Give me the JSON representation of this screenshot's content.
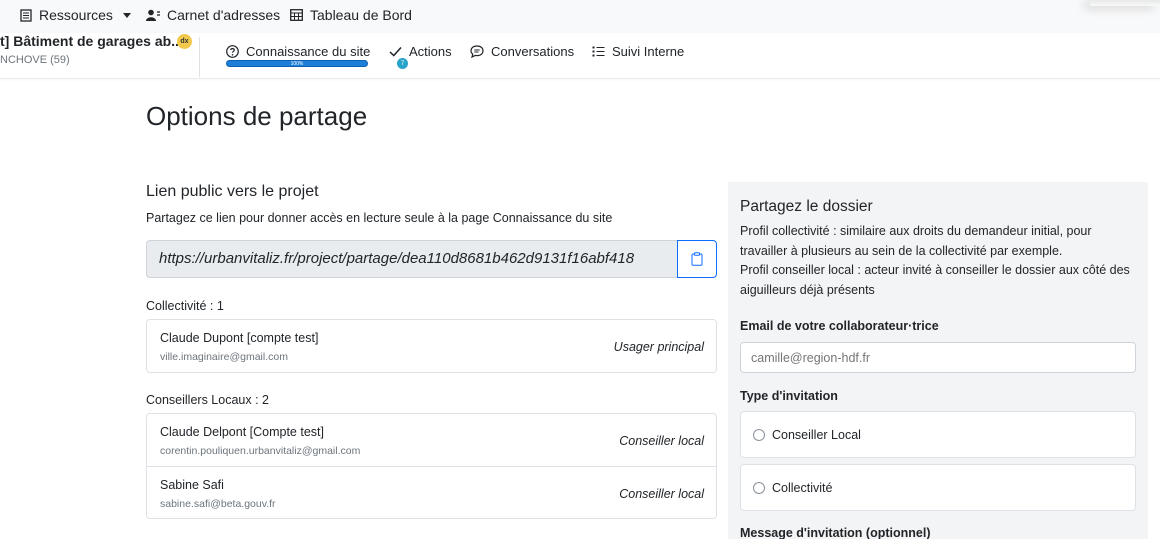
{
  "topnav": {
    "resources_label": "Ressources",
    "contacts_label": "Carnet d'adresses",
    "dashboard_label": "Tableau de Bord"
  },
  "project": {
    "title": "t] Bâtiment de garages ab...",
    "badge": "dx",
    "subtitle": "NCHOVE (59)"
  },
  "tabs": [
    {
      "label": "Connaissance du site",
      "progress_text": "100%",
      "progress": 100
    },
    {
      "label": "Actions",
      "dot": "7"
    },
    {
      "label": "Conversations"
    },
    {
      "label": "Suivi Interne"
    }
  ],
  "main": {
    "page_title": "Options de partage",
    "public_link": {
      "title": "Lien public vers le projet",
      "description": "Partagez ce lien pour donner accès en lecture seule à la page Connaissance du site",
      "url": "https://urbanvitaliz.fr/project/partage/dea110d8681b462d9131f16abf418"
    },
    "collectivite": {
      "label": "Collectivité : 1",
      "members": [
        {
          "name": "Claude Dupont [compte test]",
          "email": "ville.imaginaire@gmail.com",
          "role": "Usager principal"
        }
      ]
    },
    "conseillers": {
      "label": "Conseillers Locaux : 2",
      "members": [
        {
          "name": "Claude Delpont [Compte test]",
          "email": "corentin.pouliquen.urbanvitaliz@gmail.com",
          "role": "Conseiller local"
        },
        {
          "name": "Sabine Safi",
          "email": "sabine.safi@beta.gouv.fr",
          "role": "Conseiller local"
        }
      ]
    }
  },
  "share_panel": {
    "title": "Partagez le dossier",
    "desc_line1": "Profil collectivité : similaire aux droits du demandeur initial, pour travailler à plusieurs au sein de la collectivité par exemple.",
    "desc_line2": "Profil conseiller local : acteur invité à conseiller le dossier aux côté des aiguilleurs déjà présents",
    "email_label": "Email de votre collaborateur·trice",
    "email_placeholder": "camille@region-hdf.fr",
    "invite_type_label": "Type d'invitation",
    "options": [
      "Conseiller Local",
      "Collectivité"
    ],
    "message_label": "Message d'invitation (optionnel)"
  },
  "colors": {
    "primary": "#0d6efd",
    "progress": "#1c7ed6",
    "badge": "#f2c94c",
    "panel_bg": "#f3f4f5"
  }
}
